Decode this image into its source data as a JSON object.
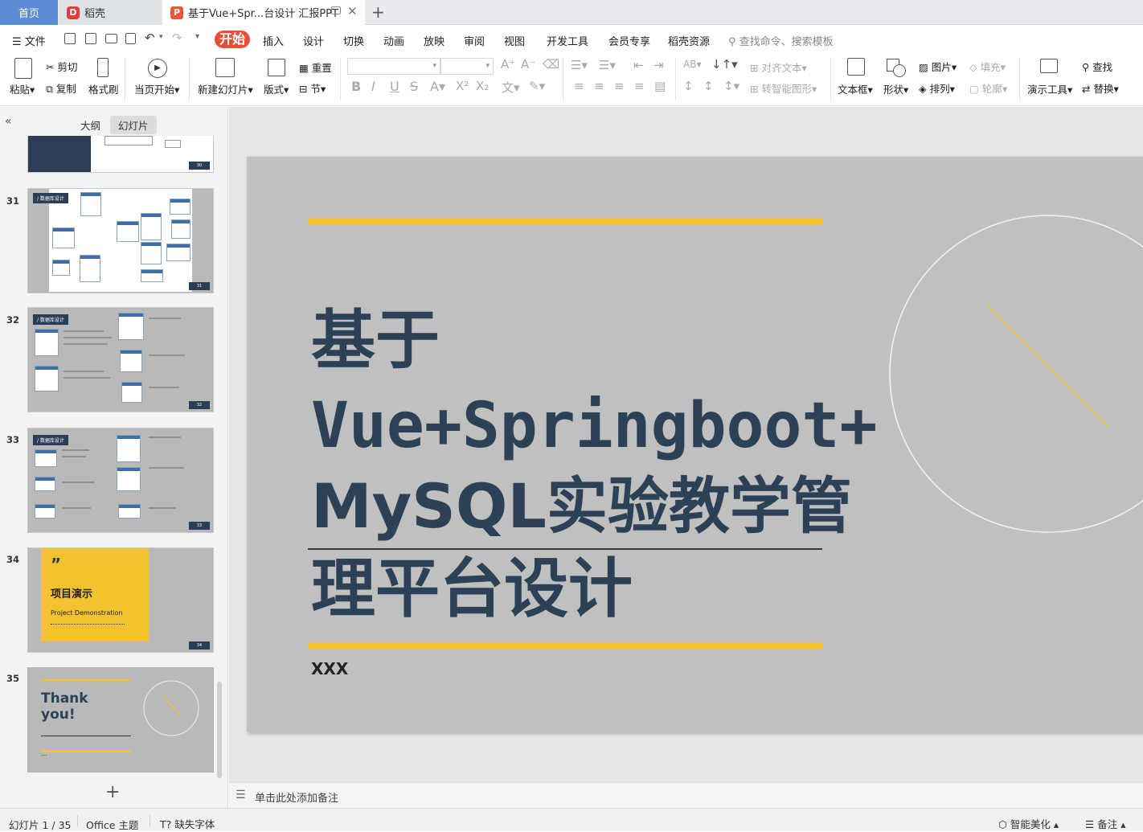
{
  "tabs": {
    "home": "首页",
    "docer": "稻壳",
    "document": "基于Vue+Spr...台设计 汇报PPT",
    "new_tab": "+"
  },
  "menu": {
    "file": "文件",
    "items": [
      "开始",
      "插入",
      "设计",
      "切换",
      "动画",
      "放映",
      "审阅",
      "视图",
      "开发工具",
      "会员专享",
      "稻壳资源"
    ],
    "search": "查找命令、搜索模板"
  },
  "ribbon": {
    "paste": "粘贴",
    "cut": "剪切",
    "copy": "复制",
    "format_painter": "格式刷",
    "from_current": "当页开始",
    "new_slide": "新建幻灯片",
    "layout": "版式",
    "reset": "重置",
    "section": "节",
    "align_text": "对齐文本",
    "smart_shape": "转智能图形",
    "textbox": "文本框",
    "shape": "形状",
    "picture": "图片",
    "arrange": "排列",
    "fill": "填充",
    "outline": "轮廓",
    "presenter_tools": "演示工具",
    "find": "查找",
    "replace": "替换"
  },
  "leftpane": {
    "tab_outline": "大纲",
    "tab_slides": "幻灯片",
    "add": "+",
    "thumbs": [
      {
        "num": "31",
        "label": "/ 数据库设计",
        "page": "31"
      },
      {
        "num": "32",
        "label": "/ 数据库设计",
        "page": "32"
      },
      {
        "num": "33",
        "label": "/ 数据库设计",
        "page": "33"
      },
      {
        "num": "34",
        "title": "项目演示",
        "subtitle": "Project Demonstration",
        "quote": "”",
        "page": "34"
      },
      {
        "num": "35",
        "title": "Thank you!",
        "footer": "...",
        "page": ""
      }
    ],
    "partial_page": "30"
  },
  "slide": {
    "title_line1": "基于",
    "title_line2": "Vue+Springboot+",
    "title_line3": "MySQL实验教学管",
    "title_line4": "理平台设计",
    "author": "XXX",
    "colors": {
      "bg": "#c0c0c0",
      "accent": "#f5c22f",
      "text": "#2c4056"
    }
  },
  "notes": {
    "placeholder": "单击此处添加备注"
  },
  "status": {
    "slide_index": "幻灯片 1 / 35",
    "theme": "Office 主题",
    "missing_font": "缺失字体",
    "beautify": "智能美化",
    "notes": "备注"
  }
}
